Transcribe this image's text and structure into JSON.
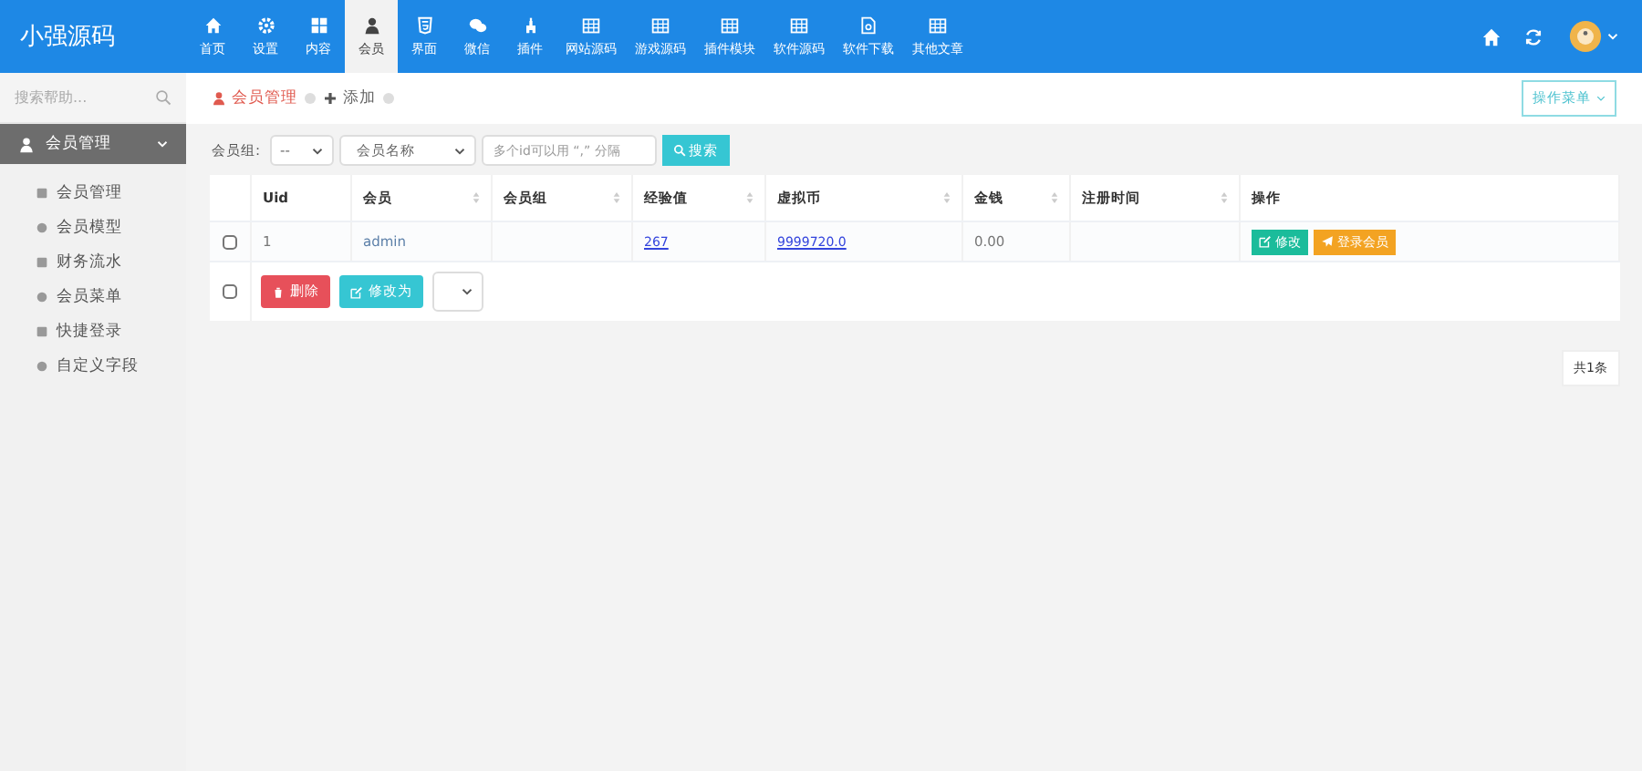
{
  "logo": "小强源码",
  "nav": [
    {
      "label": "首页",
      "selected": false
    },
    {
      "label": "设置",
      "selected": false
    },
    {
      "label": "内容",
      "selected": false
    },
    {
      "label": "会员",
      "selected": true
    },
    {
      "label": "界面",
      "selected": false
    },
    {
      "label": "微信",
      "selected": false
    },
    {
      "label": "插件",
      "selected": false
    },
    {
      "label": "网站源码",
      "selected": false
    },
    {
      "label": "游戏源码",
      "selected": false
    },
    {
      "label": "插件模块",
      "selected": false
    },
    {
      "label": "软件源码",
      "selected": false
    },
    {
      "label": "软件下载",
      "selected": false
    },
    {
      "label": "其他文章",
      "selected": false
    }
  ],
  "sidebar": {
    "search_placeholder": "搜索帮助...",
    "section": {
      "label": "会员管理",
      "expanded": true
    },
    "items": [
      {
        "label": "会员管理"
      },
      {
        "label": "会员模型"
      },
      {
        "label": "财务流水"
      },
      {
        "label": "会员菜单"
      },
      {
        "label": "快捷登录"
      },
      {
        "label": "自定义字段"
      }
    ]
  },
  "tabs": [
    {
      "label": "会员管理",
      "selected": true
    },
    {
      "label": "添加",
      "selected": false
    }
  ],
  "ops_menu": "操作菜单",
  "filter": {
    "label": "会员组:",
    "group_value": "--",
    "field_value": "会员名称",
    "placeholder": "多个id可以用 “,” 分隔",
    "search": "搜索"
  },
  "table": {
    "columns": [
      {
        "label": "Uid",
        "sortable": false
      },
      {
        "label": "会员",
        "sortable": true
      },
      {
        "label": "会员组",
        "sortable": true
      },
      {
        "label": "经验值",
        "sortable": true
      },
      {
        "label": "虚拟币",
        "sortable": true
      },
      {
        "label": "金钱",
        "sortable": true
      },
      {
        "label": "注册时间",
        "sortable": true
      },
      {
        "label": "操作",
        "sortable": false
      }
    ],
    "rows": [
      {
        "checked": false,
        "uid": "1",
        "member": "admin",
        "group": "",
        "exp": "267",
        "coin": "9999720.0",
        "money": "0.00",
        "actions": [
          "修改",
          "登录会员"
        ]
      }
    ],
    "footer": {
      "checked": false,
      "delete": "删除",
      "change": "修改为"
    }
  },
  "pagination": "共1条"
}
